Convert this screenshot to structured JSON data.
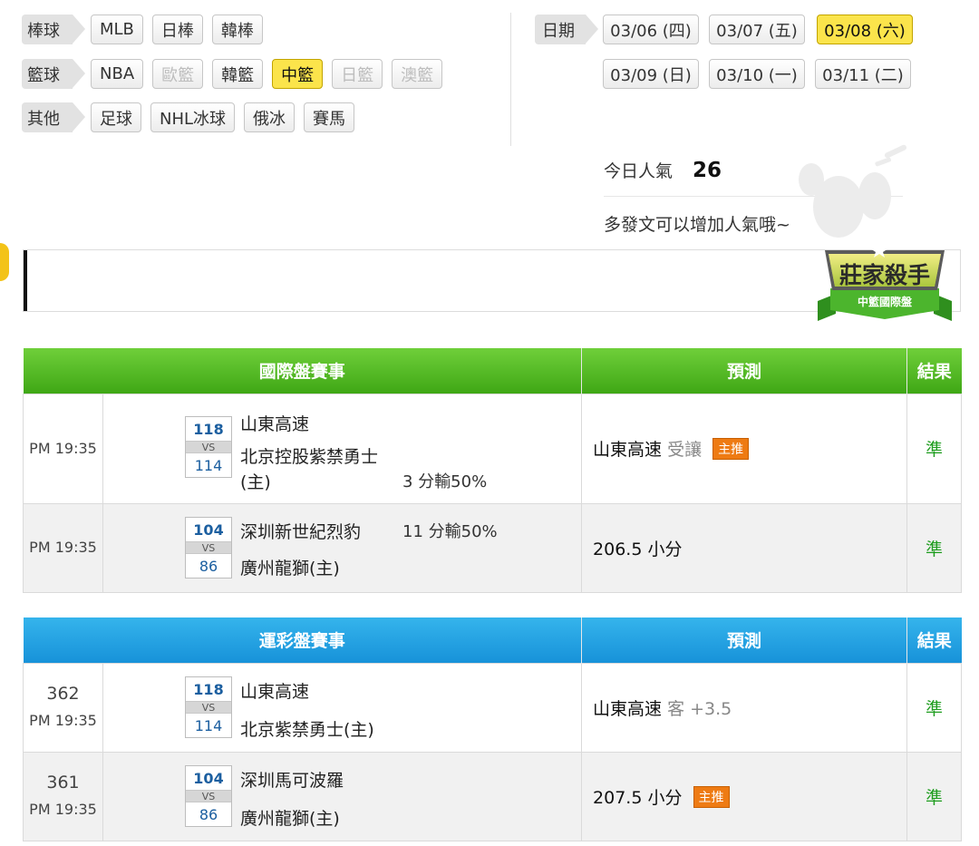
{
  "categories": [
    {
      "label": "棒球",
      "items": [
        {
          "label": "MLB",
          "state": "normal"
        },
        {
          "label": "日棒",
          "state": "normal"
        },
        {
          "label": "韓棒",
          "state": "normal"
        }
      ]
    },
    {
      "label": "籃球",
      "items": [
        {
          "label": "NBA",
          "state": "normal"
        },
        {
          "label": "歐籃",
          "state": "disabled"
        },
        {
          "label": "韓籃",
          "state": "normal"
        },
        {
          "label": "中籃",
          "state": "active"
        },
        {
          "label": "日籃",
          "state": "disabled"
        },
        {
          "label": "澳籃",
          "state": "disabled"
        }
      ]
    },
    {
      "label": "其他",
      "items": [
        {
          "label": "足球",
          "state": "normal"
        },
        {
          "label": "NHL冰球",
          "state": "normal"
        },
        {
          "label": "俄冰",
          "state": "normal"
        },
        {
          "label": "賽馬",
          "state": "normal"
        }
      ]
    }
  ],
  "dates": {
    "label": "日期",
    "items": [
      {
        "label": "03/06 (四)",
        "active": false
      },
      {
        "label": "03/07 (五)",
        "active": false
      },
      {
        "label": "03/08 (六)",
        "active": true
      },
      {
        "label": "03/09 (日)",
        "active": false
      },
      {
        "label": "03/10 (一)",
        "active": false
      },
      {
        "label": "03/11 (二)",
        "active": false
      }
    ]
  },
  "popularity": {
    "label": "今日人氣",
    "value": "26",
    "hint": "多發文可以增加人氣哦~"
  },
  "badge": {
    "title": "莊家殺手",
    "subtitle": "中籃國際盤"
  },
  "intl_table": {
    "headers": {
      "event": "國際盤賽事",
      "prediction": "預測",
      "result": "結果"
    },
    "rows": [
      {
        "time": "PM 19:35",
        "score_top": "118",
        "vs": "VS",
        "score_bottom": "114",
        "team_top": "山東高速",
        "team_bottom_line1": "北京控股紫禁勇士",
        "team_bottom_line2": "(主)",
        "handicap": "3 分輸50%",
        "pred_main": "山東高速",
        "pred_muted": "受讓",
        "pred_tag": "主推",
        "result": "準"
      },
      {
        "time": "PM 19:35",
        "score_top": "104",
        "vs": "VS",
        "score_bottom": "86",
        "team_top": "深圳新世紀烈豹",
        "team_bottom": "廣州龍獅(主)",
        "handicap": "11 分輸50%",
        "pred_main": "206.5 小分",
        "result": "準"
      }
    ]
  },
  "lottery_table": {
    "headers": {
      "event": "運彩盤賽事",
      "prediction": "預測",
      "result": "結果"
    },
    "rows": [
      {
        "game_no": "362",
        "time": "PM 19:35",
        "score_top": "118",
        "vs": "VS",
        "score_bottom": "114",
        "team_top": "山東高速",
        "team_bottom": "北京紫禁勇士(主)",
        "pred_main": "山東高速",
        "pred_muted": "客 +3.5",
        "result": "準"
      },
      {
        "game_no": "361",
        "time": "PM 19:35",
        "score_top": "104",
        "vs": "VS",
        "score_bottom": "86",
        "team_top": "深圳馬可波羅",
        "team_bottom": "廣州龍獅(主)",
        "pred_main": "207.5 小分",
        "pred_tag": "主推",
        "result": "準"
      }
    ]
  }
}
